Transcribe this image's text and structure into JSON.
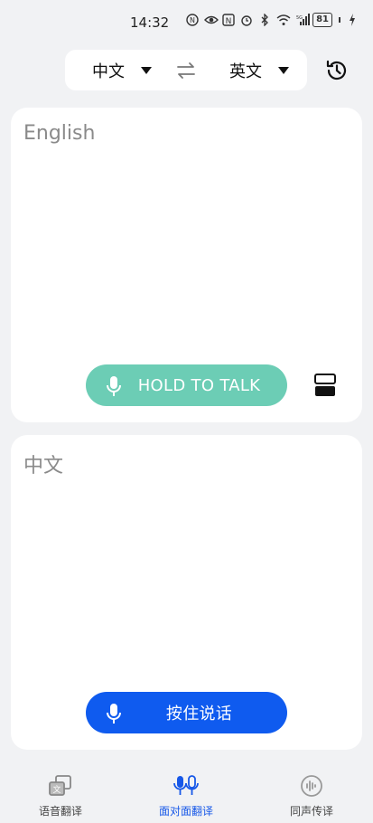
{
  "status_bar": {
    "time": "14:32",
    "battery": "81",
    "icons": [
      "nfc-icon",
      "eye-icon",
      "n-icon",
      "alarm-icon",
      "bluetooth-icon",
      "wifi-icon",
      "signal-5g-icon",
      "battery-icon",
      "charging-icon"
    ]
  },
  "language_bar": {
    "source_language": "中文",
    "target_language": "英文",
    "swap_icon": "swap-arrows-icon",
    "history_icon": "history-icon"
  },
  "top_panel": {
    "label": "English",
    "button_label": "HOLD TO TALK",
    "button_color": "#6ccdb5",
    "split_icon": "split-screen-icon"
  },
  "bottom_panel": {
    "label": "中文",
    "button_label": "按住说话",
    "button_color": "#0f5bef"
  },
  "tabs": [
    {
      "label": "语音翻译",
      "icon": "translate-icon",
      "active": false
    },
    {
      "label": "面对面翻译",
      "icon": "face-to-face-mic-icon",
      "active": true
    },
    {
      "label": "同声传译",
      "icon": "simultaneous-icon",
      "active": false
    }
  ],
  "accent_color": "#1758e8"
}
